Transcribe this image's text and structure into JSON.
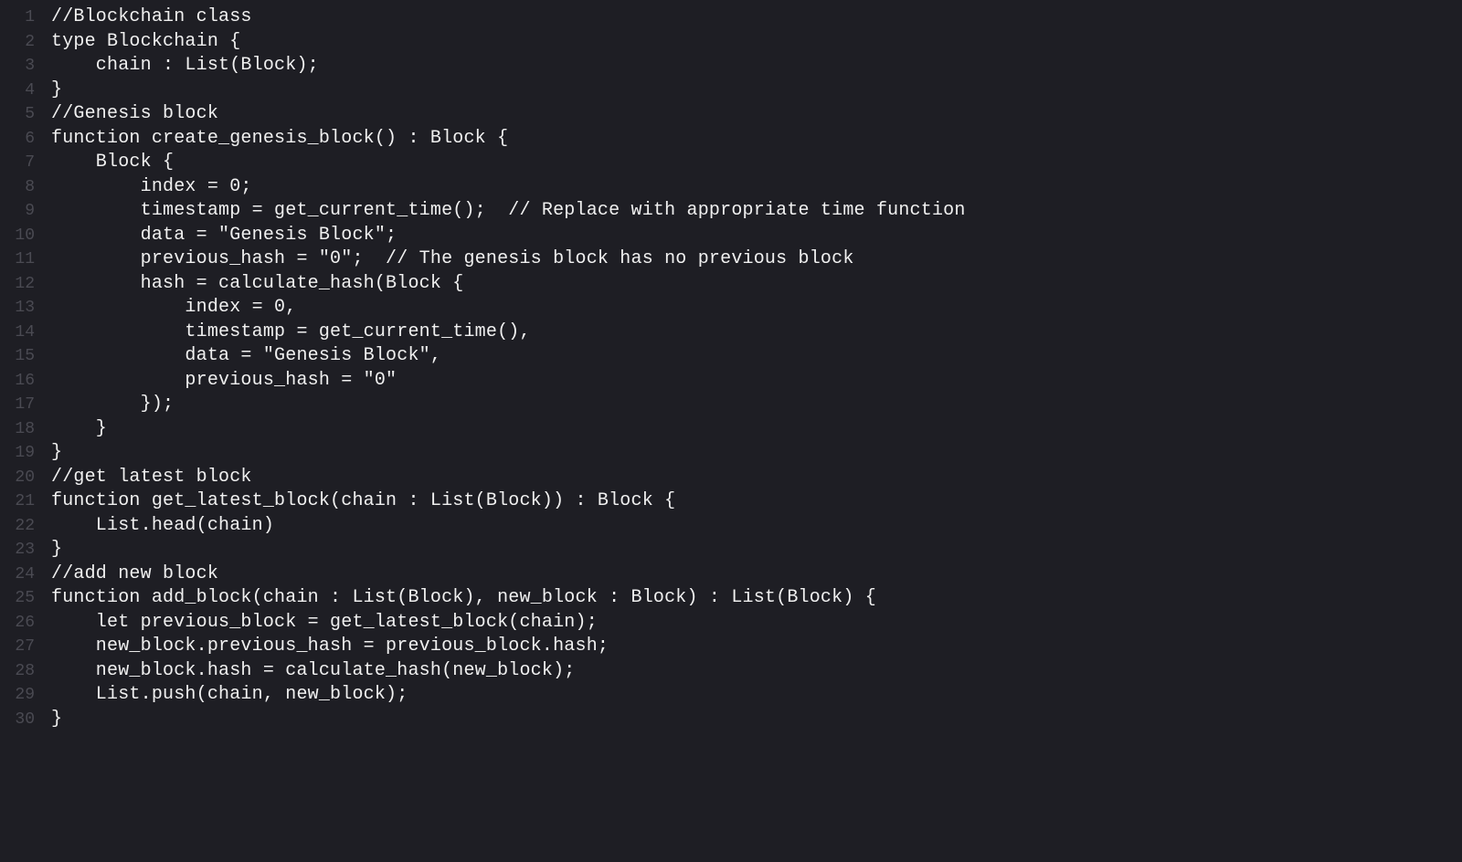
{
  "editor": {
    "lines": [
      {
        "n": "1",
        "text": "//Blockchain class"
      },
      {
        "n": "2",
        "text": "type Blockchain {"
      },
      {
        "n": "3",
        "text": "    chain : List(Block);"
      },
      {
        "n": "4",
        "text": "}"
      },
      {
        "n": "5",
        "text": "//Genesis block"
      },
      {
        "n": "6",
        "text": "function create_genesis_block() : Block {"
      },
      {
        "n": "7",
        "text": "    Block {"
      },
      {
        "n": "8",
        "text": "        index = 0;"
      },
      {
        "n": "9",
        "text": "        timestamp = get_current_time();  // Replace with appropriate time function"
      },
      {
        "n": "10",
        "text": "        data = \"Genesis Block\";"
      },
      {
        "n": "11",
        "text": "        previous_hash = \"0\";  // The genesis block has no previous block"
      },
      {
        "n": "12",
        "text": "        hash = calculate_hash(Block {"
      },
      {
        "n": "13",
        "text": "            index = 0,"
      },
      {
        "n": "14",
        "text": "            timestamp = get_current_time(),"
      },
      {
        "n": "15",
        "text": "            data = \"Genesis Block\","
      },
      {
        "n": "16",
        "text": "            previous_hash = \"0\""
      },
      {
        "n": "17",
        "text": "        });"
      },
      {
        "n": "18",
        "text": "    }"
      },
      {
        "n": "19",
        "text": "}"
      },
      {
        "n": "20",
        "text": "//get latest block"
      },
      {
        "n": "21",
        "text": "function get_latest_block(chain : List(Block)) : Block {"
      },
      {
        "n": "22",
        "text": "    List.head(chain)"
      },
      {
        "n": "23",
        "text": "}"
      },
      {
        "n": "24",
        "text": "//add new block"
      },
      {
        "n": "25",
        "text": "function add_block(chain : List(Block), new_block : Block) : List(Block) {"
      },
      {
        "n": "26",
        "text": "    let previous_block = get_latest_block(chain);"
      },
      {
        "n": "27",
        "text": "    new_block.previous_hash = previous_block.hash;"
      },
      {
        "n": "28",
        "text": "    new_block.hash = calculate_hash(new_block);"
      },
      {
        "n": "29",
        "text": "    List.push(chain, new_block);"
      },
      {
        "n": "30",
        "text": "}"
      }
    ]
  }
}
